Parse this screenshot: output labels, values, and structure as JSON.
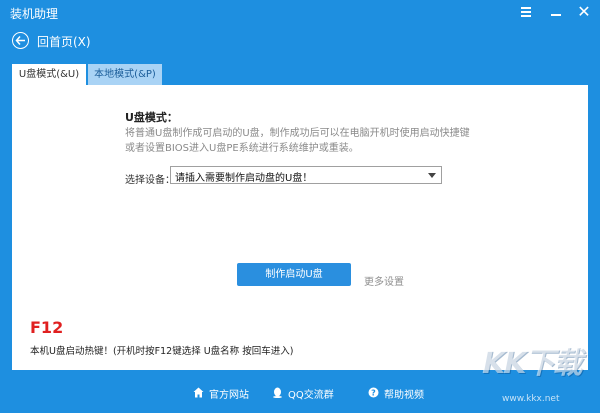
{
  "app": {
    "title": "装机助理"
  },
  "nav": {
    "back_label": "回首页(X)"
  },
  "tabs": [
    {
      "label": "U盘模式(&U)",
      "active": true
    },
    {
      "label": "本地模式(&P)",
      "active": false
    }
  ],
  "usb_mode": {
    "title": "U盘模式：",
    "description": "将普通U盘制作成可启动的U盘，制作成功后可以在电脑开机时使用启动快捷键或者设置BIOS进入U盘PE系统进行系统维护或重装。",
    "select_label": "选择设备：",
    "select_value": "请插入需要制作启动盘的U盘！",
    "make_button": "制作启动U盘",
    "more_settings": "更多设置",
    "hotkey": "F12",
    "hotkey_desc": "本机U盘启动热键！(开机时按F12键选择 U盘名称 按回车进入)"
  },
  "footer": {
    "site": "官方网站",
    "qq": "QQ交流群",
    "help": "帮助视频"
  },
  "watermark": {
    "logo": "KK下载",
    "url": "www.kkx.net"
  },
  "colors": {
    "chrome": "#1e8fe0",
    "button": "#2a8fdf",
    "hotkey": "#e02020",
    "inactive_tab": "#a9d3f5"
  },
  "icons": {
    "menu": "menu-icon",
    "minimize": "minimize-icon",
    "close": "close-icon",
    "back": "back-arrow-icon",
    "site": "home-icon",
    "qq": "qq-penguin-icon",
    "help": "help-icon"
  }
}
